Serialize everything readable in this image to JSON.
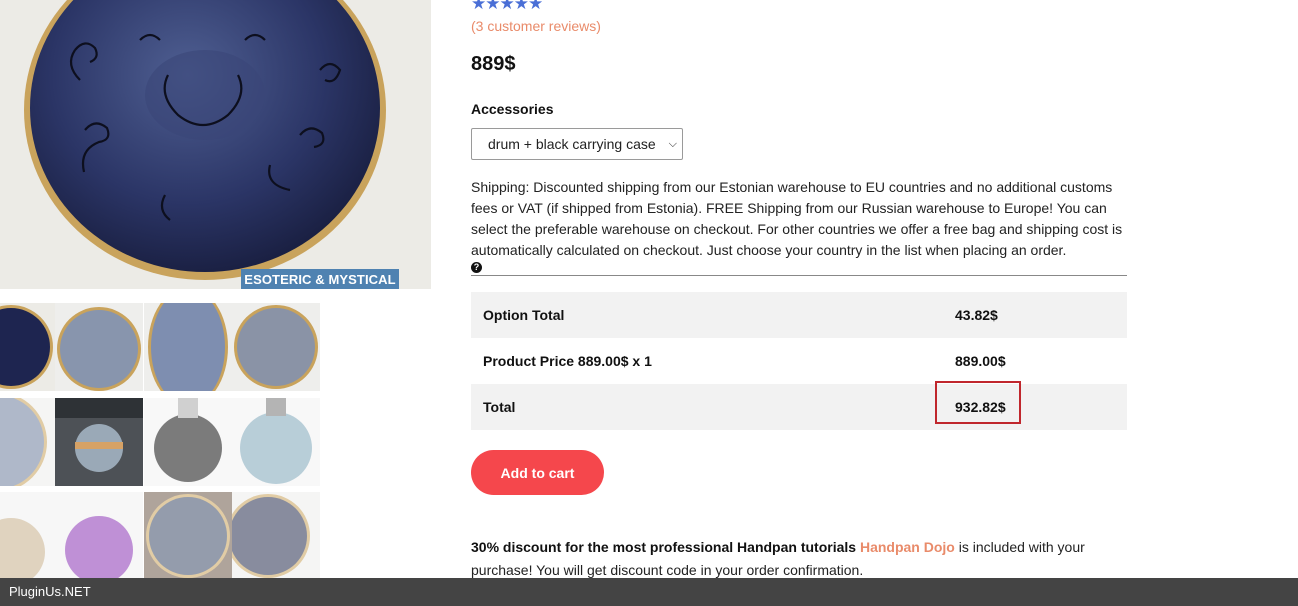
{
  "gallery": {
    "badge": "ESOTERIC & MYSTICAL",
    "thumbnail_count": 12
  },
  "product": {
    "stars": "★★★★★",
    "rating_stars": 5,
    "reviews_link": "(3 customer reviews)",
    "price": "889$"
  },
  "accessories": {
    "label": "Accessories",
    "selected": "drum + black carrying case",
    "chevron_icon": "chevron-down-icon"
  },
  "shipping": {
    "text": "Shipping: Discounted shipping from our Estonian warehouse to EU countries and no additional customs fees or VAT (if shipped from Estonia). FREE Shipping from our Russian warehouse to Europe! You can select the preferable warehouse on checkout. For other countries we offer a free bag and shipping cost is automatically calculated on checkout. Just choose your country in the list when placing an order.",
    "help_icon": "?"
  },
  "totals": [
    {
      "label": "Option Total",
      "value": "43.82$"
    },
    {
      "label": "Product Price 889.00$ x 1",
      "value": "889.00$"
    },
    {
      "label": "Total",
      "value": "932.82$"
    }
  ],
  "cart": {
    "button_label": "Add to cart"
  },
  "promo": {
    "bold_text": "30% discount for the most professional Handpan tutorials",
    "link_text": "Handpan Dojo",
    "rest_text": " is included with your purchase! You will get discount code in your order confirmation."
  },
  "footer": {
    "brand": "PluginUs.NET"
  },
  "colors": {
    "accent": "#f5474c",
    "link": "#e98b6a",
    "star": "#4a6fd6",
    "badge": "#4f82b1",
    "highlight_border": "#c0272d",
    "footer_bg": "#444444"
  }
}
